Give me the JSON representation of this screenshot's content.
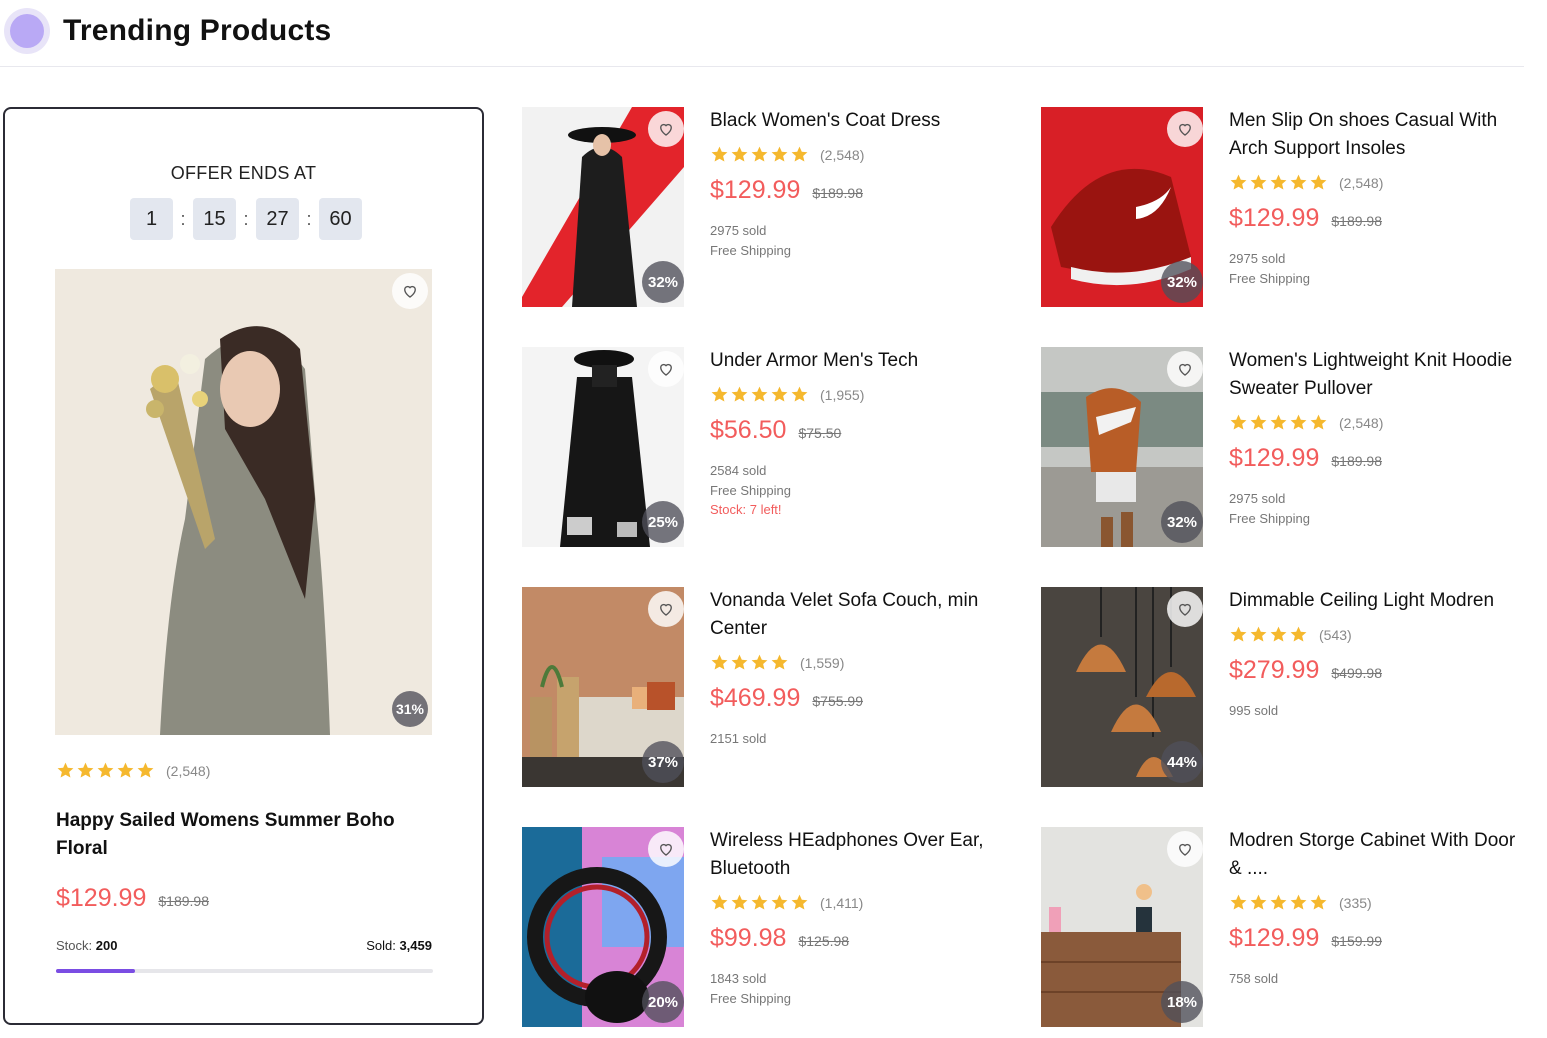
{
  "header": {
    "title": "Trending Products"
  },
  "featured": {
    "offer_label": "OFFER ENDS AT",
    "timer": [
      "1",
      "15",
      "27",
      "60"
    ],
    "discount": "31%",
    "rating": 5,
    "reviews": "(2,548)",
    "name": "Happy Sailed Womens Summer Boho Floral",
    "price": "$129.99",
    "old_price": "$189.98",
    "stock_label": "Stock:",
    "stock_value": "200",
    "sold_label": "Sold:",
    "sold_value": "3,459",
    "progress_fraction": 0.21
  },
  "colors": {
    "accent": "#f25c5c",
    "star": "#f5b82e",
    "progress": "#7a4de3"
  },
  "products": [
    {
      "name": "Black Women's Coat Dress",
      "rating": 5,
      "reviews": "(2,548)",
      "price": "$129.99",
      "old_price": "$189.98",
      "discount": "32%",
      "meta": [
        "2975 sold",
        "Free Shipping"
      ],
      "warn": ""
    },
    {
      "name": "Men Slip On shoes Casual With Arch Support Insoles",
      "rating": 5,
      "reviews": "(2,548)",
      "price": "$129.99",
      "old_price": "$189.98",
      "discount": "32%",
      "meta": [
        "2975 sold",
        "Free Shipping"
      ],
      "warn": ""
    },
    {
      "name": "Under Armor Men's Tech",
      "rating": 5,
      "reviews": "(1,955)",
      "price": "$56.50",
      "old_price": "$75.50",
      "discount": "25%",
      "meta": [
        "2584 sold",
        "Free Shipping"
      ],
      "warn": "Stock: 7 left!"
    },
    {
      "name": "Women's Lightweight Knit Hoodie Sweater Pullover",
      "rating": 5,
      "reviews": "(2,548)",
      "price": "$129.99",
      "old_price": "$189.98",
      "discount": "32%",
      "meta": [
        "2975 sold",
        "Free Shipping"
      ],
      "warn": ""
    },
    {
      "name": "Vonanda Velet Sofa Couch, min Center",
      "rating": 4,
      "reviews": "(1,559)",
      "price": "$469.99",
      "old_price": "$755.99",
      "discount": "37%",
      "meta": [
        "2151 sold"
      ],
      "warn": ""
    },
    {
      "name": "Dimmable Ceiling Light Modren",
      "rating": 4,
      "reviews": "(543)",
      "price": "$279.99",
      "old_price": "$499.98",
      "discount": "44%",
      "meta": [
        "995 sold"
      ],
      "warn": ""
    },
    {
      "name": "Wireless HEadphones Over Ear, Bluetooth",
      "rating": 5,
      "reviews": "(1,411)",
      "price": "$99.98",
      "old_price": "$125.98",
      "discount": "20%",
      "meta": [
        "1843 sold",
        "Free Shipping"
      ],
      "warn": ""
    },
    {
      "name": "Modren Storge Cabinet With Door & ....",
      "rating": 5,
      "reviews": "(335)",
      "price": "$129.99",
      "old_price": "$159.99",
      "discount": "18%",
      "meta": [
        "758 sold"
      ],
      "warn": ""
    }
  ]
}
